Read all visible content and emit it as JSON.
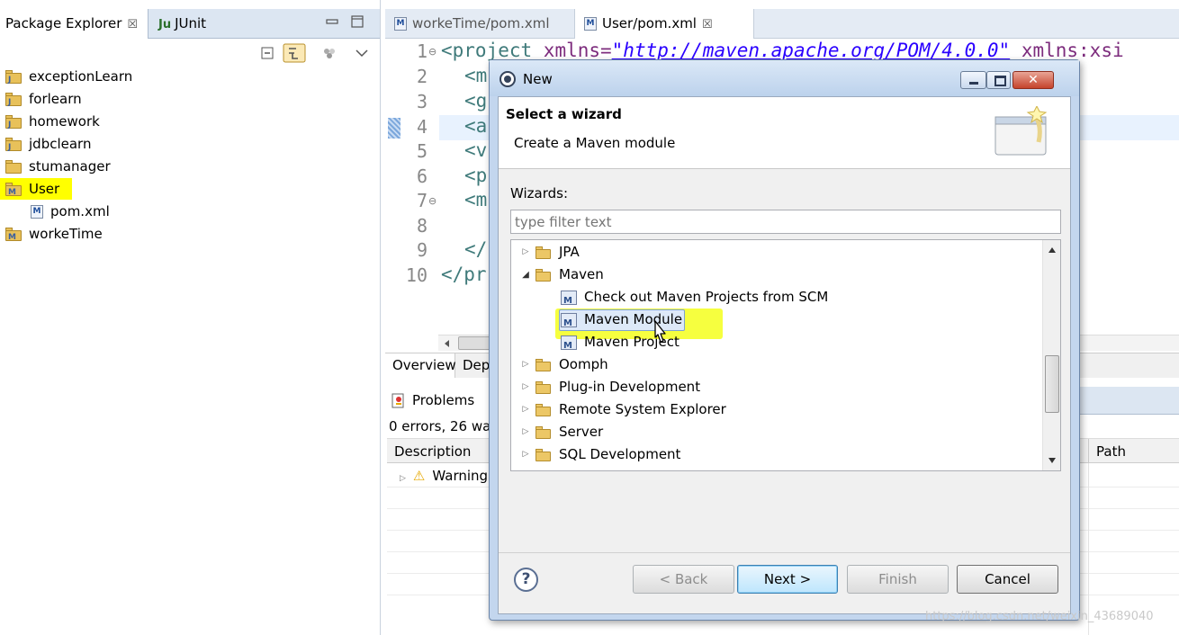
{
  "package_explorer": {
    "tab_label": "Package Explorer",
    "close_glyph": "☒",
    "junit_label": "JUnit",
    "junit_prefix": "Ju",
    "projects": [
      {
        "label": "exceptionLearn"
      },
      {
        "label": "forlearn"
      },
      {
        "label": "homework"
      },
      {
        "label": "jdbclearn"
      },
      {
        "label": "stumanager"
      },
      {
        "label": "User",
        "highlighted": true
      },
      {
        "label": "pom.xml",
        "child": true
      },
      {
        "label": "workeTime"
      }
    ]
  },
  "editor": {
    "tabs": [
      {
        "label": "workeTime/pom.xml"
      },
      {
        "label": "User/pom.xml",
        "active": true
      }
    ],
    "tab_close_glyph": "☒",
    "line_numbers": [
      "1",
      "2",
      "3",
      "4",
      "5",
      "6",
      "7",
      "8",
      "9",
      "10"
    ],
    "lines": {
      "l1_tag": "<project ",
      "l1_attr1": "xmlns=",
      "l1_val1": "\"http://maven.apache.org/POM/4.0.0\"",
      "l1_attr2": " xmlns:xsi",
      "l2": "<m",
      "l3": "<g",
      "l4": "<a",
      "l5": "<v",
      "l6": "<p",
      "l7": "<m",
      "l8": "",
      "l9": "</",
      "l10": "</pr"
    },
    "bottom_tabs": [
      "Overview",
      "Dep"
    ]
  },
  "problems": {
    "tab_label": "Problems",
    "summary": "0 errors, 26 wa",
    "col_description": "Description",
    "col_path": "Path",
    "row_label": "Warning"
  },
  "dialog": {
    "title": "New",
    "heading": "Select a wizard",
    "subheading": "Create a Maven module",
    "wizards_label": "Wizards:",
    "filter_placeholder": "type filter text",
    "tree": [
      {
        "label": "JPA",
        "kind": "folder",
        "expanded": false
      },
      {
        "label": "Maven",
        "kind": "folder",
        "expanded": true
      },
      {
        "label": "Check out Maven Projects from SCM",
        "kind": "wizard"
      },
      {
        "label": "Maven Module",
        "kind": "wizard",
        "selected": true
      },
      {
        "label": "Maven Project",
        "kind": "wizard"
      },
      {
        "label": "Oomph",
        "kind": "folder",
        "expanded": false
      },
      {
        "label": "Plug-in Development",
        "kind": "folder",
        "expanded": false
      },
      {
        "label": "Remote System Explorer",
        "kind": "folder",
        "expanded": false
      },
      {
        "label": "Server",
        "kind": "folder",
        "expanded": false
      },
      {
        "label": "SQL Development",
        "kind": "folder",
        "expanded": false
      }
    ],
    "help_glyph": "?",
    "buttons": {
      "back": "< Back",
      "next": "Next >",
      "finish": "Finish",
      "cancel": "Cancel"
    },
    "close_glyph": "✕"
  },
  "watermark": "https://blog.csdn.net/weixin_43689040",
  "colors": {
    "highlight": "#ffff00",
    "dialog_frame": "#c3d6ee",
    "next_button": "#bee6fd"
  }
}
